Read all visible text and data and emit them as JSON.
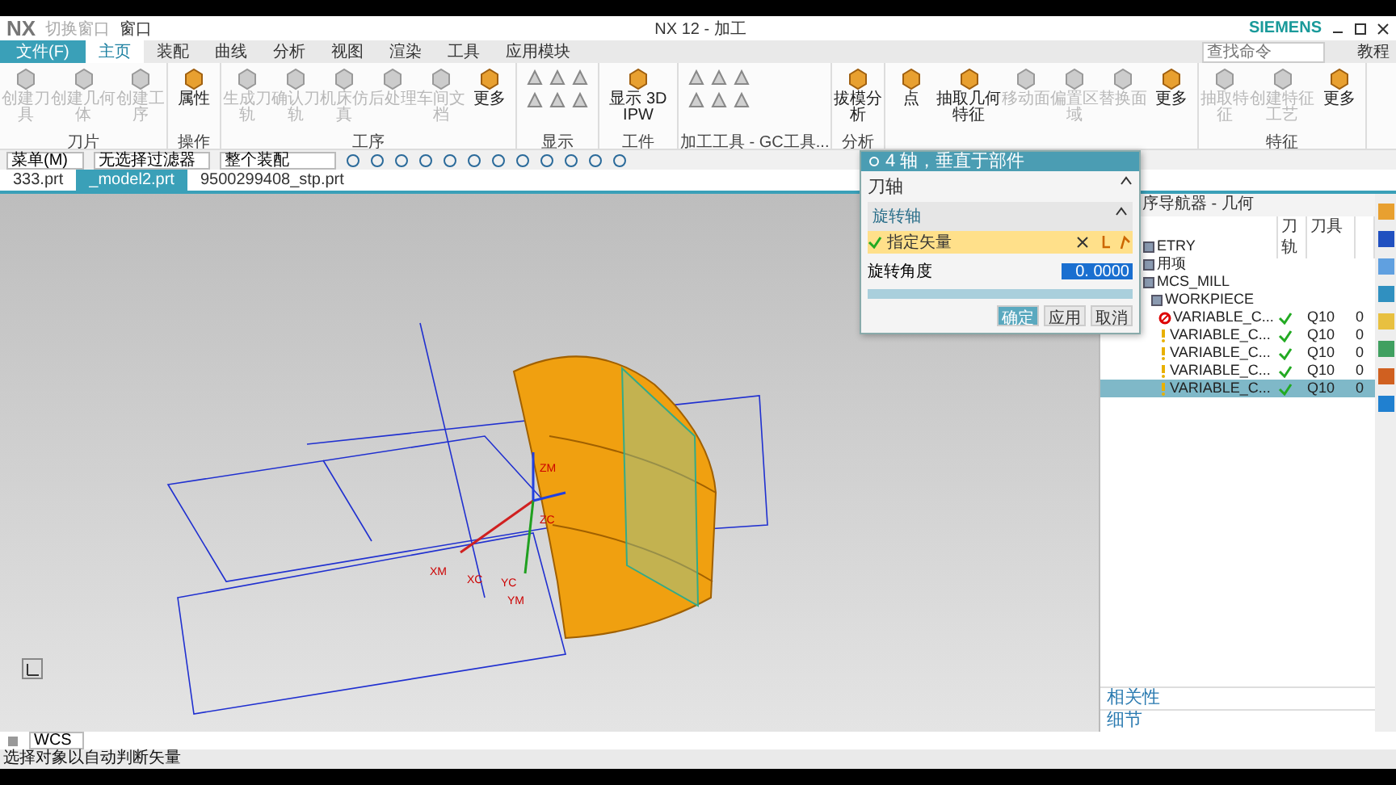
{
  "window": {
    "logo": "NX",
    "title": "NX 12 - 加工",
    "brand": "SIEMENS"
  },
  "quick_access": [
    {
      "label": "切换窗口",
      "disabled": true
    },
    {
      "label": "窗口",
      "disabled": false
    }
  ],
  "menu_tabs": [
    {
      "label": "文件(F)",
      "kind": "file",
      "selected": false
    },
    {
      "label": "主页",
      "kind": "tab",
      "selected": true
    },
    {
      "label": "装配",
      "kind": "tab",
      "selected": false
    },
    {
      "label": "曲线",
      "kind": "tab",
      "selected": false
    },
    {
      "label": "分析",
      "kind": "tab",
      "selected": false
    },
    {
      "label": "视图",
      "kind": "tab",
      "selected": false
    },
    {
      "label": "渲染",
      "kind": "tab",
      "selected": false
    },
    {
      "label": "工具",
      "kind": "tab",
      "selected": false
    },
    {
      "label": "应用模块",
      "kind": "tab",
      "selected": false
    }
  ],
  "search": {
    "placeholder": "查找命令"
  },
  "help": {
    "label": "教程"
  },
  "ribbon_groups": [
    {
      "label": "刀片",
      "kind": "buttons",
      "items": [
        {
          "label": "创建刀具",
          "disabled": true
        },
        {
          "label": "创建几何体",
          "disabled": true
        },
        {
          "label": "创建工序",
          "disabled": true
        }
      ]
    },
    {
      "label": "操作",
      "kind": "buttons",
      "items": [
        {
          "label": "属性",
          "disabled": false
        }
      ]
    },
    {
      "label": "工序",
      "kind": "buttons",
      "items": [
        {
          "label": "生成刀轨",
          "disabled": true
        },
        {
          "label": "确认刀轨",
          "disabled": true
        },
        {
          "label": "机床仿真",
          "disabled": true
        },
        {
          "label": "后处理",
          "disabled": true
        },
        {
          "label": "车间文档",
          "disabled": true
        },
        {
          "label": "更多",
          "disabled": false
        }
      ]
    },
    {
      "label": "显示",
      "kind": "icons"
    },
    {
      "label": "工件",
      "kind": "buttons",
      "items": [
        {
          "label": "显示 3D IPW",
          "disabled": false
        }
      ]
    },
    {
      "label": "加工工具 - GC工具...",
      "kind": "icons"
    },
    {
      "label": "分析",
      "kind": "buttons",
      "items": [
        {
          "label": "拔模分析",
          "disabled": false
        }
      ]
    },
    {
      "kind": "buttons",
      "items": [
        {
          "label": "点",
          "disabled": false
        },
        {
          "label": "抽取几何特征",
          "disabled": false
        },
        {
          "label": "移动面",
          "disabled": true
        },
        {
          "label": "偏置区域",
          "disabled": true
        },
        {
          "label": "替换面",
          "disabled": true
        },
        {
          "label": "更多",
          "disabled": false
        }
      ]
    },
    {
      "label": "特征",
      "kind": "buttons",
      "items": [
        {
          "label": "抽取特征",
          "disabled": true
        },
        {
          "label": "创建特征工艺",
          "disabled": true
        },
        {
          "label": "更多",
          "disabled": false
        }
      ]
    }
  ],
  "toolbar": {
    "menu": "菜单(M)",
    "filters": [
      "无选择过滤器",
      "整个装配"
    ]
  },
  "file_tabs": [
    {
      "label": "333.prt",
      "selected": false
    },
    {
      "label": "_model2.prt",
      "selected": true
    },
    {
      "label": "9500299408_stp.prt",
      "selected": false
    }
  ],
  "viewport": {
    "axis_labels": [
      "ZM",
      "ZC",
      "XM",
      "XC",
      "YC",
      "YM"
    ]
  },
  "dialog": {
    "title": "4 轴，垂直于部件",
    "section": "刀轴",
    "subsection": "旋转轴",
    "vector_label": "指定矢量",
    "vector_specified": true,
    "angle_label": "旋转角度",
    "angle_value": "0. 0000",
    "buttons": [
      {
        "label": "确定",
        "selected": true
      },
      {
        "label": "应用",
        "selected": false
      },
      {
        "label": "取消",
        "selected": false
      }
    ]
  },
  "navigator": {
    "title": "序导航器 - 几何",
    "columns": [
      "",
      "刀轨",
      "刀具"
    ],
    "rows": [
      {
        "name": "ETRY",
        "kind": "group",
        "path_ok": false,
        "selected": false
      },
      {
        "name": "用项",
        "kind": "group",
        "path_ok": false,
        "selected": false
      },
      {
        "name": "MCS_MILL",
        "kind": "group",
        "path_ok": false,
        "selected": false,
        "children": [
          {
            "name": "WORKPIECE",
            "kind": "group",
            "path_ok": false,
            "selected": false,
            "children": [
              {
                "name": "VARIABLE_C...",
                "kind": "error",
                "path_ok": true,
                "tool": "Q10",
                "column_4": "0",
                "selected": false
              },
              {
                "name": "VARIABLE_C...",
                "kind": "warning",
                "path_ok": true,
                "tool": "Q10",
                "column_4": "0",
                "selected": false
              },
              {
                "name": "VARIABLE_C...",
                "kind": "warning",
                "path_ok": true,
                "tool": "Q10",
                "column_4": "0",
                "selected": false
              },
              {
                "name": "VARIABLE_C...",
                "kind": "warning",
                "path_ok": true,
                "tool": "Q10",
                "column_4": "0",
                "selected": false
              },
              {
                "name": "VARIABLE_C...",
                "kind": "warning",
                "path_ok": true,
                "tool": "Q10",
                "column_4": "0",
                "selected": true
              }
            ]
          }
        ]
      }
    ],
    "panels": [
      "相关性",
      "细节"
    ]
  },
  "bottom_bar": {
    "wcs": "WCS"
  },
  "status_bar": "选择对象以自动判断矢量"
}
